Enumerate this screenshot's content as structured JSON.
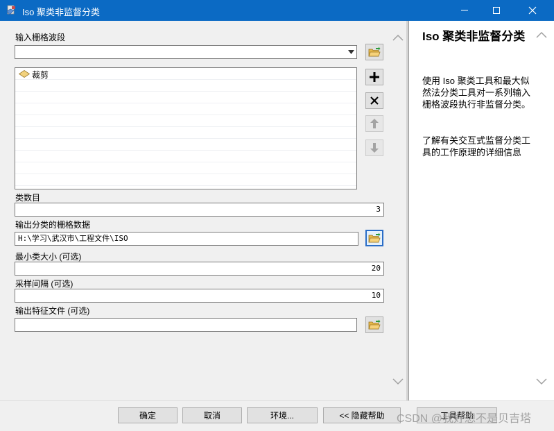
{
  "window": {
    "title": "Iso 聚类非监督分类",
    "minimize_label": "—",
    "maximize_label": "☐",
    "close_label": "✕"
  },
  "form": {
    "input_bands_label": "输入栅格波段",
    "input_bands_value": "",
    "bands_list": [
      {
        "label": "裁剪",
        "icon": "raster-layer-icon"
      },
      {
        "label": ""
      },
      {
        "label": ""
      },
      {
        "label": ""
      },
      {
        "label": ""
      },
      {
        "label": ""
      },
      {
        "label": ""
      },
      {
        "label": ""
      },
      {
        "label": ""
      },
      {
        "label": ""
      }
    ],
    "num_classes_label": "类数目",
    "num_classes_value": "3",
    "output_raster_label": "输出分类的栅格数据",
    "output_raster_value": "H:\\学习\\武汉市\\工程文件\\ISO",
    "min_class_size_label": "最小类大小 (可选)",
    "min_class_size_value": "20",
    "sample_interval_label": "采样间隔 (可选)",
    "sample_interval_value": "10",
    "output_signature_label": "输出特征文件 (可选)",
    "output_signature_value": ""
  },
  "icons": {
    "browse": "folder-open-icon",
    "add": "plus-icon",
    "remove": "x-icon",
    "move_up": "arrow-up-icon",
    "move_down": "arrow-down-icon"
  },
  "help": {
    "title": "Iso 聚类非监督分类",
    "paragraph1": "使用 Iso 聚类工具和最大似然法分类工具对一系列输入栅格波段执行非监督分类。",
    "paragraph2": "了解有关交互式监督分类工具的工作原理的详细信息"
  },
  "buttons": {
    "ok": "确定",
    "cancel": "取消",
    "environments": "环境...",
    "hide_help": "<< 隐藏帮助",
    "tool_help": "工具帮助"
  },
  "watermark": "CSDN @我好想不是贝吉塔",
  "colors": {
    "titlebar": "#0b6ac4",
    "selected_border": "#2a6dc7"
  }
}
